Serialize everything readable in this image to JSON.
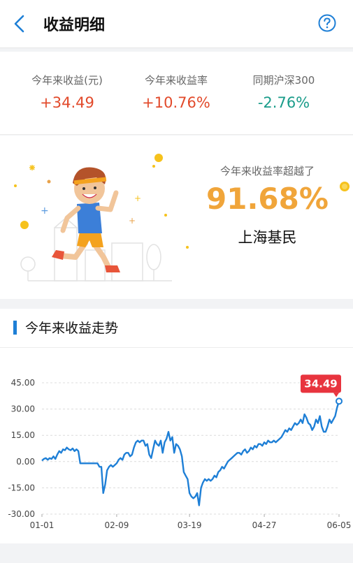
{
  "header": {
    "title": "收益明细",
    "back_icon": "chevron-left-icon",
    "help_icon": "question-circle-icon"
  },
  "stats": [
    {
      "label": "今年来收益(元)",
      "value": "+34.49",
      "tone": "pos"
    },
    {
      "label": "今年来收益率",
      "value": "+10.76%",
      "tone": "pos"
    },
    {
      "label": "同期沪深300",
      "value": "-2.76%",
      "tone": "neg"
    }
  ],
  "ranking": {
    "label": "今年来收益率超越了",
    "value": "91.68%",
    "group": "上海基民"
  },
  "trend": {
    "title": "今年来收益走势"
  },
  "colors": {
    "accent": "#1e7fd6",
    "positive": "#e24a2b",
    "negative": "#1a9c8a",
    "rank": "#f0a53a",
    "tag": "#e8343e"
  },
  "chart_data": {
    "type": "line",
    "title": "",
    "xlabel": "",
    "ylabel": "",
    "ylim": [
      -30,
      45
    ],
    "yticks": [
      "45.00",
      "30.00",
      "15.00",
      "0.00",
      "-15.00",
      "-30.00"
    ],
    "ytick_values": [
      45,
      30,
      15,
      0,
      -15,
      -30
    ],
    "xticks": [
      "01-01",
      "02-09",
      "03-19",
      "04-27",
      "06-05"
    ],
    "xtick_positions": [
      0,
      39,
      77,
      116,
      155
    ],
    "last_value_label": "34.49",
    "grid": true,
    "series": [
      {
        "values": [
          [
            0,
            0.5
          ],
          [
            1,
            1.5
          ],
          [
            2,
            2
          ],
          [
            3,
            1
          ],
          [
            4,
            2
          ],
          [
            5,
            1.5
          ],
          [
            6,
            3
          ],
          [
            7,
            1.5
          ],
          [
            8,
            4
          ],
          [
            9,
            6
          ],
          [
            10,
            5
          ],
          [
            11,
            7
          ],
          [
            12,
            6.5
          ],
          [
            13,
            8
          ],
          [
            14,
            7
          ],
          [
            15,
            6.5
          ],
          [
            16,
            7.5
          ],
          [
            17,
            6
          ],
          [
            18,
            7
          ],
          [
            19,
            6
          ],
          [
            20,
            -1
          ],
          [
            21,
            -1
          ],
          [
            22,
            -1
          ],
          [
            23,
            -1
          ],
          [
            24,
            -1
          ],
          [
            25,
            -1
          ],
          [
            26,
            -1
          ],
          [
            27,
            -1
          ],
          [
            28,
            -1
          ],
          [
            29,
            -1
          ],
          [
            30,
            -3
          ],
          [
            31,
            -3
          ],
          [
            32,
            -18
          ],
          [
            33,
            -13
          ],
          [
            34,
            -5
          ],
          [
            35,
            -3
          ],
          [
            36,
            -2
          ],
          [
            37,
            -3
          ],
          [
            38,
            -2
          ],
          [
            39,
            -1
          ],
          [
            40,
            1
          ],
          [
            41,
            2
          ],
          [
            42,
            1
          ],
          [
            43,
            4
          ],
          [
            44,
            5
          ],
          [
            45,
            5
          ],
          [
            46,
            3
          ],
          [
            47,
            4
          ],
          [
            48,
            8
          ],
          [
            49,
            11
          ],
          [
            50,
            12
          ],
          [
            51,
            11
          ],
          [
            52,
            12
          ],
          [
            53,
            12
          ],
          [
            54,
            9
          ],
          [
            55,
            10
          ],
          [
            56,
            4
          ],
          [
            57,
            2
          ],
          [
            58,
            7
          ],
          [
            59,
            12
          ],
          [
            60,
            10
          ],
          [
            61,
            9
          ],
          [
            62,
            12
          ],
          [
            63,
            5
          ],
          [
            64,
            11
          ],
          [
            65,
            13
          ],
          [
            66,
            17
          ],
          [
            67,
            12
          ],
          [
            68,
            14
          ],
          [
            69,
            5
          ],
          [
            70,
            10
          ],
          [
            71,
            9
          ],
          [
            72,
            7
          ],
          [
            73,
            3
          ],
          [
            74,
            -6
          ],
          [
            75,
            -8
          ],
          [
            76,
            -10
          ],
          [
            77,
            -18
          ],
          [
            78,
            -20
          ],
          [
            79,
            -21
          ],
          [
            80,
            -20
          ],
          [
            81,
            -18
          ],
          [
            82,
            -25
          ],
          [
            83,
            -15
          ],
          [
            84,
            -12
          ],
          [
            85,
            -10
          ],
          [
            86,
            -11
          ],
          [
            87,
            -10
          ],
          [
            88,
            -11
          ],
          [
            89,
            -10
          ],
          [
            90,
            -8
          ],
          [
            91,
            -9
          ],
          [
            92,
            -6
          ],
          [
            93,
            -5
          ],
          [
            94,
            -3
          ],
          [
            95,
            -4
          ],
          [
            96,
            -2
          ],
          [
            97,
            0
          ],
          [
            98,
            1
          ],
          [
            99,
            2
          ],
          [
            100,
            3
          ],
          [
            101,
            4
          ],
          [
            102,
            5
          ],
          [
            103,
            5
          ],
          [
            104,
            4
          ],
          [
            105,
            6
          ],
          [
            106,
            7
          ],
          [
            107,
            5
          ],
          [
            108,
            6
          ],
          [
            109,
            8
          ],
          [
            110,
            7
          ],
          [
            111,
            9
          ],
          [
            112,
            8
          ],
          [
            113,
            10
          ],
          [
            114,
            10
          ],
          [
            115,
            9
          ],
          [
            116,
            11
          ],
          [
            117,
            10
          ],
          [
            118,
            12
          ],
          [
            119,
            11
          ],
          [
            120,
            11
          ],
          [
            121,
            12
          ],
          [
            122,
            11
          ],
          [
            123,
            12
          ],
          [
            124,
            13
          ],
          [
            125,
            14
          ],
          [
            126,
            16
          ],
          [
            127,
            18
          ],
          [
            128,
            17
          ],
          [
            129,
            19
          ],
          [
            130,
            18
          ],
          [
            131,
            20
          ],
          [
            132,
            22
          ],
          [
            133,
            21
          ],
          [
            134,
            22
          ],
          [
            135,
            24
          ],
          [
            136,
            22
          ],
          [
            137,
            27
          ],
          [
            138,
            25
          ],
          [
            139,
            22
          ],
          [
            140,
            21
          ],
          [
            141,
            18
          ],
          [
            142,
            20
          ],
          [
            143,
            24
          ],
          [
            144,
            22
          ],
          [
            145,
            26
          ],
          [
            146,
            20
          ],
          [
            147,
            17
          ],
          [
            148,
            17
          ],
          [
            149,
            20
          ],
          [
            150,
            24
          ],
          [
            151,
            22
          ],
          [
            152,
            24
          ],
          [
            153,
            26
          ],
          [
            154,
            31
          ],
          [
            155,
            34.49
          ]
        ]
      }
    ]
  }
}
